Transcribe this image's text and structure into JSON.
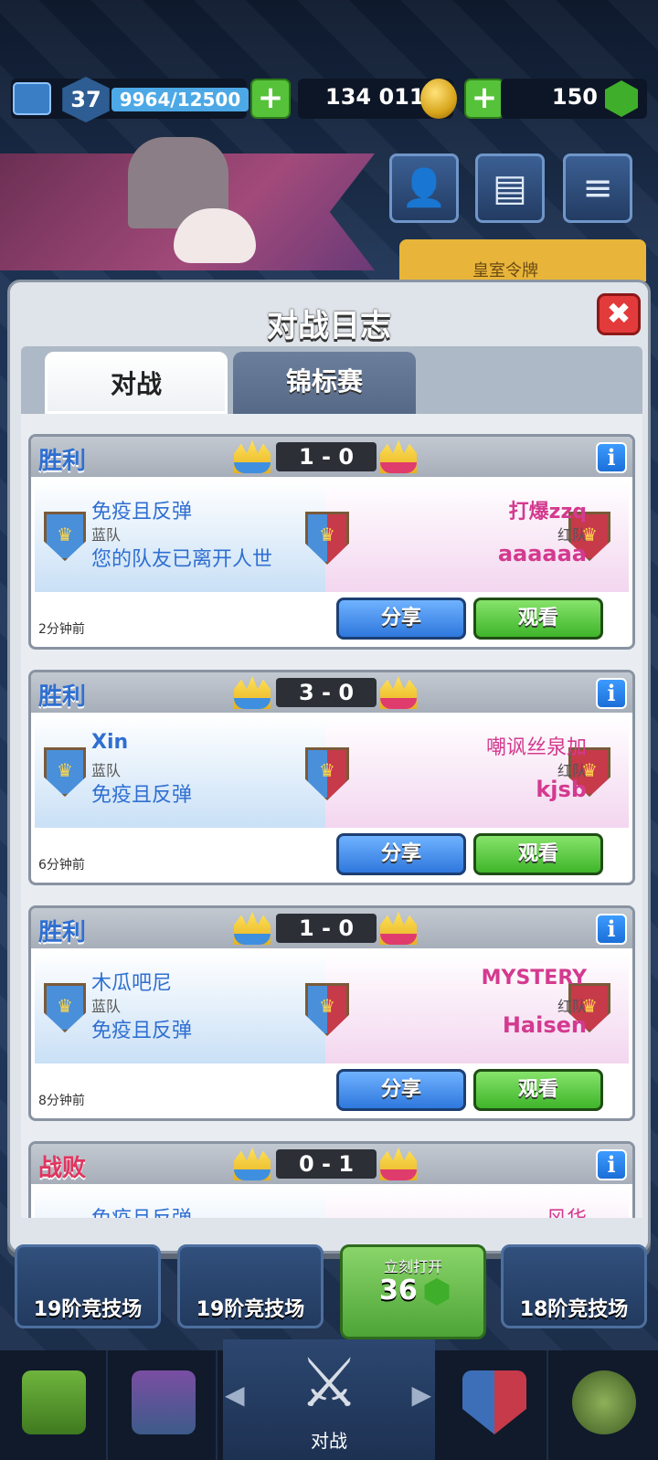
{
  "topbar": {
    "level": "37",
    "xp": "9964/12500",
    "gold": "134 011",
    "gems": "150",
    "plus": "+"
  },
  "banner": {
    "royal_pass": "皇室令牌"
  },
  "modal": {
    "title": "对战日志",
    "close": "✖",
    "tabs": [
      "对战",
      "锦标赛"
    ]
  },
  "battles": [
    {
      "result": "胜利",
      "score": "1 - 0",
      "left_name": "免疫且反弹",
      "left_team": "蓝队",
      "left_mate": "您的队友已离开人世",
      "right_name": "打爆zzq",
      "right_team": "红队",
      "right_mate": "aaaaaa",
      "time": "2分钟前",
      "share": "分享",
      "watch": "观看"
    },
    {
      "result": "胜利",
      "score": "3 - 0",
      "left_name": "Xin",
      "left_team": "蓝队",
      "left_mate": "免疫且反弹",
      "right_name": "嘲讽丝泉加",
      "right_team": "红队",
      "right_mate": "kjsb",
      "time": "6分钟前",
      "share": "分享",
      "watch": "观看"
    },
    {
      "result": "胜利",
      "score": "1 - 0",
      "left_name": "木瓜吧尼",
      "left_team": "蓝队",
      "left_mate": "免疫且反弹",
      "right_name": "MYSTERY",
      "right_team": "红队",
      "right_mate": "Haisen",
      "time": "8分钟前",
      "share": "分享",
      "watch": "观看"
    },
    {
      "result": "战败",
      "score": "0 - 1",
      "left_name": "免疫且反弹",
      "right_name": "风华"
    }
  ],
  "chests": [
    {
      "label": "19阶竞技场"
    },
    {
      "label": "19阶竞技场"
    },
    {
      "label": "立刻打开",
      "count": "36"
    },
    {
      "label": "18阶竞技场"
    }
  ],
  "nav": {
    "active_label": "对战",
    "info_glyph": "i"
  },
  "colors": {
    "win": "#2f6fd1",
    "loss": "#e0355f",
    "red_player": "#d43a8f"
  }
}
